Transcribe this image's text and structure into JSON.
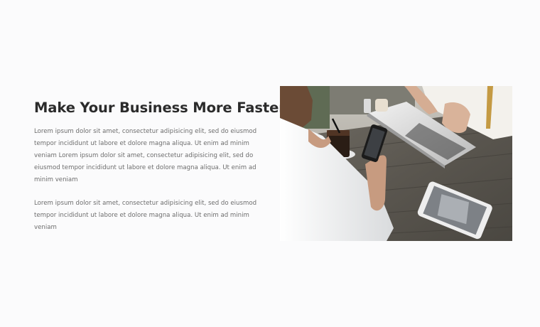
{
  "section": {
    "title": "Make Your Business More Faster",
    "paragraph_1": "Lorem ipsum dolor sit amet, consectetur adipisicing elit, sed do eiusmod tempor incididunt ut labore et dolore magna aliqua. Ut enim ad minim veniam Lorem ipsum dolor sit amet, consectetur adipisicing elit, sed do eiusmod tempor incididunt ut labore et dolore magna aliqua. Ut enim ad minim veniam",
    "paragraph_2": "Lorem ipsum dolor sit amet, consectetur adipisicing elit, sed do eiusmod tempor incididunt ut labore et dolore magna aliqua. Ut enim ad minim veniam"
  },
  "colors": {
    "background": "#fbfbfc",
    "heading": "#2b2b2b",
    "body_text": "#6d6d6d"
  }
}
